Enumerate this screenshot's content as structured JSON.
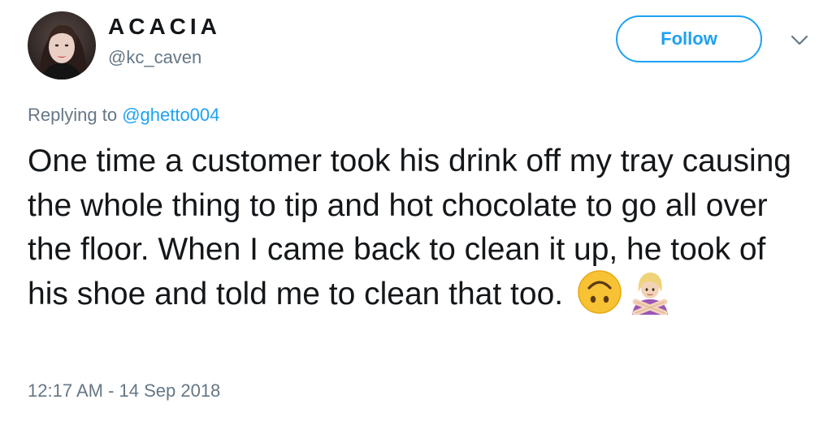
{
  "author": {
    "display_name": "ACACIA",
    "handle": "@kc_caven"
  },
  "actions": {
    "follow_label": "Follow",
    "menu_icon": "chevron-down-icon"
  },
  "reply": {
    "prefix": "Replying to ",
    "mention": "@ghetto004"
  },
  "tweet": {
    "text": "One time a customer took his drink off my tray causing the whole thing to tip and hot chocolate to go all over the floor. When I came back to clean it up, he took of his shoe and told me to clean that too.",
    "emojis": [
      "upside-down-face-emoji",
      "person-gesturing-no-emoji"
    ]
  },
  "meta": {
    "timestamp": "12:17 AM - 14 Sep 2018"
  },
  "colors": {
    "accent": "#1da1f2",
    "secondary_text": "#657786",
    "primary_text": "#14171a"
  }
}
